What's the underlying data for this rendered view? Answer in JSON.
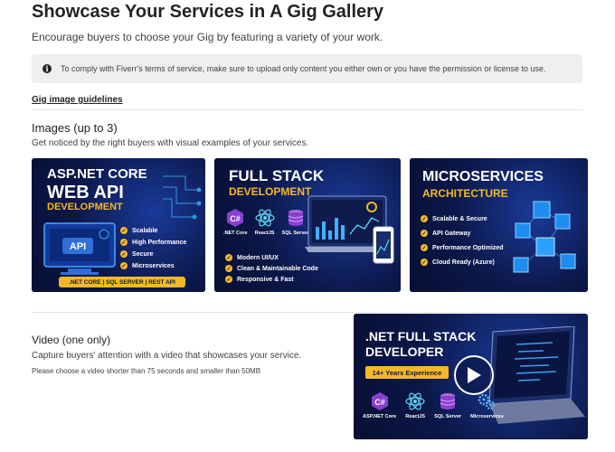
{
  "header": {
    "title": "Showcase Your Services in A Gig Gallery",
    "subtitle": "Encourage buyers to choose your Gig by featuring a variety of your work."
  },
  "notice": {
    "icon": "info-icon",
    "text": "To comply with Fiverr's terms of service, make sure to upload only content you either own or you have the permission or license to use."
  },
  "guidelines_link": "Gig image guidelines",
  "images": {
    "title": "Images (up to 3)",
    "description": "Get noticed by the right buyers with visual examples of your services.",
    "cards": [
      {
        "title_line1": "ASP.NET CORE",
        "title_line2": "WEB API",
        "subtitle": "DEVELOPMENT",
        "features": [
          "Scalable",
          "High Performance",
          "Secure",
          "Microservices"
        ],
        "tag_bar": ".NET CORE  |  SQL SERVER  |  REST API",
        "illustration_label": "API"
      },
      {
        "title_line1": "FULL STACK",
        "subtitle": "DEVELOPMENT",
        "tech": [
          ".NET Core",
          "ReactJS",
          "SQL Server"
        ],
        "features": [
          "Modern UI/UX",
          "Clean & Maintainable Code",
          "Responsive & Fast"
        ]
      },
      {
        "title_line1": "MICROSERVICES",
        "subtitle": "ARCHITECTURE",
        "features": [
          "Scalable & Secure",
          "API Gateway",
          "Performance Optimized",
          "Cloud Ready (Azure)"
        ]
      }
    ]
  },
  "video": {
    "title": "Video (one only)",
    "description": "Capture buyers' attention with a video that showcases your service.",
    "limit": "Please choose a video shorter than 75 seconds and smaller than 50MB",
    "thumbnail": {
      "title_line1": ".NET FULL STACK",
      "title_line2": "DEVELOPER",
      "badge": "14+ Years Experience",
      "tech": [
        "ASP.NET Core",
        "ReactJS",
        "SQL Server",
        "Microservices"
      ]
    }
  },
  "colors": {
    "accent_yellow": "#f5b828",
    "card_navy": "#0b1748",
    "text_dark": "#222325"
  }
}
